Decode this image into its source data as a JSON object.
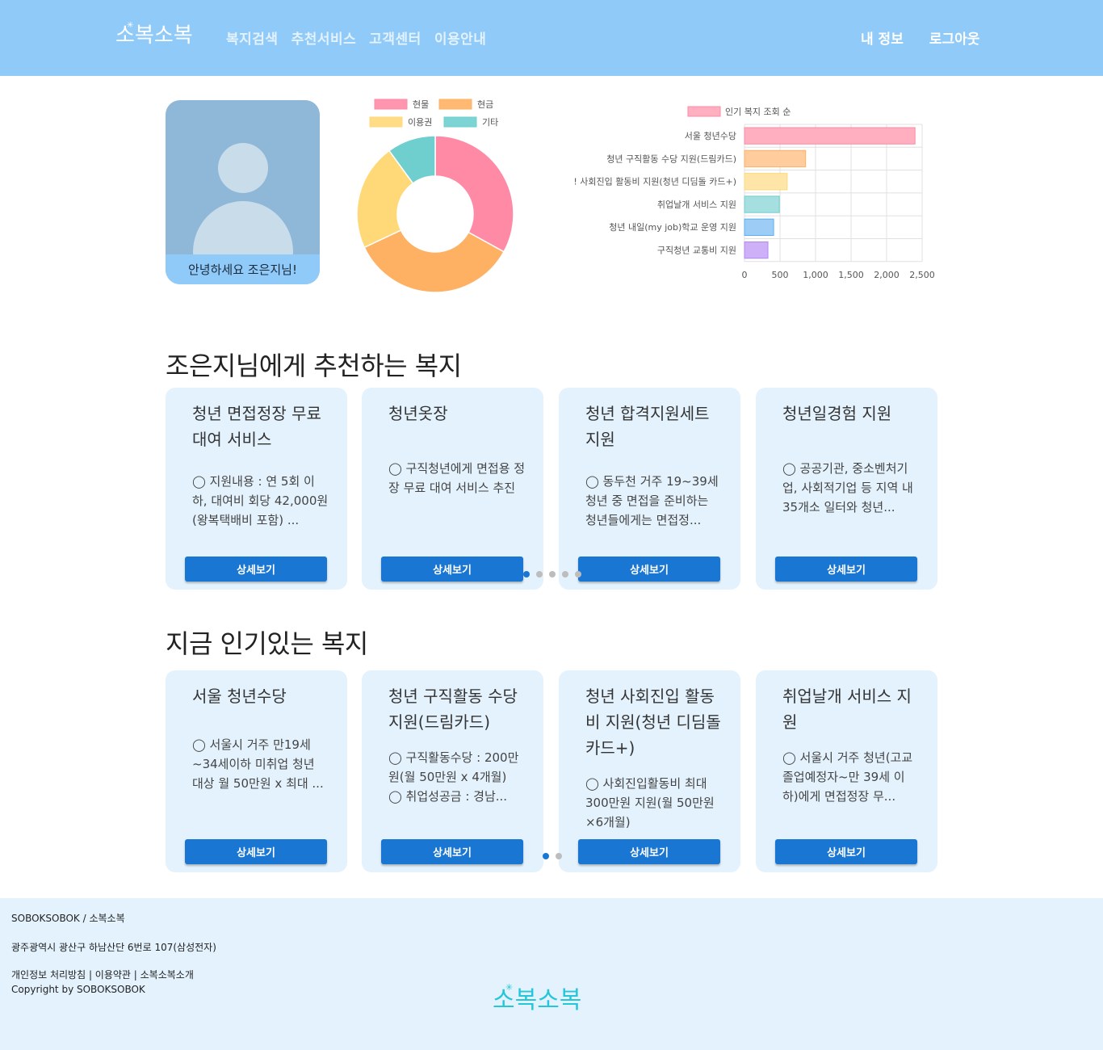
{
  "brand": {
    "logo_text": "소복소복",
    "logo_color": "#ffffff",
    "footer_logo_color": "#26c6da"
  },
  "nav": {
    "items": [
      "복지검색",
      "추천서비스",
      "고객센터",
      "이용안내"
    ]
  },
  "user_nav": {
    "my_info": "내 정보",
    "logout": "로그아웃"
  },
  "profile": {
    "greeting": "안녕하세요 조은지님!"
  },
  "chart_data": [
    {
      "type": "pie",
      "variant": "doughnut",
      "categories": [
        "현물",
        "현금",
        "이용권",
        "기타"
      ],
      "values": [
        33,
        35,
        22,
        10
      ],
      "colors": [
        "#ff8aa5",
        "#ffb163",
        "#ffd878",
        "#6fcfcf"
      ],
      "legend_position": "top"
    },
    {
      "type": "bar",
      "orientation": "horizontal",
      "series": [
        {
          "name": "인기 복지 조회 순",
          "values": [
            2400,
            860,
            600,
            490,
            410,
            330
          ]
        }
      ],
      "categories": [
        "서울 청년수당",
        "청년 구직활동 수당 지원(드림카드)",
        "! 사회진입 활동비 지원(청년 디딤돌 카드+)",
        "취업날개 서비스 지원",
        "청년 내일(my job)학교 운영 지원",
        "구직청년 교통비 지원"
      ],
      "colors": [
        "#ffafc0",
        "#ffcc9e",
        "#ffe5a8",
        "#a5dfdf",
        "#9dcdf7",
        "#cdb0f7"
      ],
      "xlim": [
        0,
        2500
      ],
      "xticks": [
        "0",
        "500",
        "1,000",
        "1,500",
        "2,000",
        "2,500"
      ],
      "grid": true,
      "legend_position": "top"
    }
  ],
  "recommend": {
    "title": "조은지님에게 추천하는 복지",
    "button_label": "상세보기",
    "cards": [
      {
        "title": "청년 면접정장 무료 대여 서비스",
        "desc": "◯ 지원내용 : 연 5회 이하, 대여비 회당 42,000원(왕복택배비 포함) ..."
      },
      {
        "title": "청년옷장",
        "desc": "◯ 구직청년에게 면접용 정장 무료 대여 서비스 추진"
      },
      {
        "title": "청년 합격지원세트 지원",
        "desc": "◯ 동두천 거주 19~39세 청년 중 면접을 준비하는 청년들에게는 면접정..."
      },
      {
        "title": "청년일경험 지원",
        "desc": "◯ 공공기관, 중소벤처기업, 사회적기업 등 지역 내 35개소 일터와 청년..."
      }
    ]
  },
  "popular": {
    "title": "지금 인기있는 복지",
    "button_label": "상세보기",
    "cards": [
      {
        "title": "서울 청년수당",
        "desc": "◯ 서울시 거주 만19세~34세이하 미취업 청년 대상 월 50만원 x 최대 ..."
      },
      {
        "title": "청년 구직활동 수당 지원(드림카드)",
        "desc": "◯ 구직활동수당 : 200만원(월 50만원 x 4개월)\n◯ 취업성공금 : 경남..."
      },
      {
        "title": "청년 사회진입 활동비 지원(청년 디딤돌 카드+)",
        "desc": "◯ 사회진입활동비 최대 300만원 지원(월 50만원 ×6개월)"
      },
      {
        "title": "취업날개 서비스 지원",
        "desc": "◯ 서울시 거주 청년(고교졸업예정자~만 39세 이하)에게 면접정장 무..."
      }
    ]
  },
  "footer": {
    "company": "SOBOKSOBOK / 소복소복",
    "address": "광주광역시 광산구 하남산단 6번로 107(삼성전자)",
    "links": "개인정보 처리방침 | 이용약관 | 소복소복소개",
    "copyright": "Copyright by SOBOKSOBOK"
  }
}
